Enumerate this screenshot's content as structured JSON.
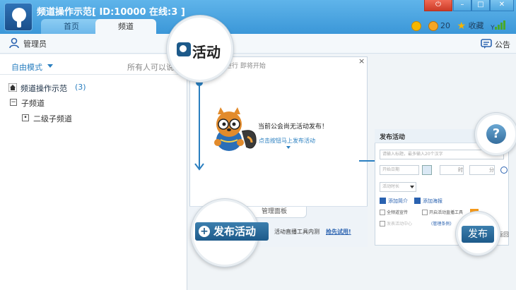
{
  "window": {
    "title": "频道操作示范[ ID:10000 在线:3 ]",
    "tabs": [
      "首页",
      "频道"
    ]
  },
  "status": {
    "coins": "20",
    "favorite_label": "收藏"
  },
  "toolbar": {
    "admin_label": "管理员",
    "notice_label": "公告"
  },
  "left_panel": {
    "mode_label": "自由模式",
    "mic_mode_label": "所有人可以说",
    "channel_name": "频道操作示范",
    "channel_count": "(3)",
    "sub_channels_label": "子频道",
    "sub_channel_2_label": "二级子频道"
  },
  "activity_panel": {
    "tabs_text": "在进行   即将开始",
    "close": "×",
    "empty_message": "当前公会尚无活动发布！",
    "publish_hint": "点击按钮马上发布活动",
    "manage_tab": "管理面板",
    "publish_button": "发布活动",
    "live_tool_text": "活动直播工具内测",
    "try_link": "抢先试用!"
  },
  "magnifier": {
    "activity_title": "活动",
    "help_symbol": "?"
  },
  "publish_form": {
    "title": "发布活动",
    "title_placeholder": "请输入标题，最多输入20个汉字",
    "date_placeholder": "开始日期",
    "hour_label": "时",
    "minute_label": "分",
    "duration_label": "活动时长",
    "add_intro": "添加简介",
    "add_poster": "添加海报",
    "checkbox_1": "全频道宣传",
    "checkbox_2": "开启活动直播工具",
    "checkbox_3": "发表活动中心",
    "rules_link": "(管理条例)",
    "publish_button": "发布",
    "cut_text": "返回"
  }
}
